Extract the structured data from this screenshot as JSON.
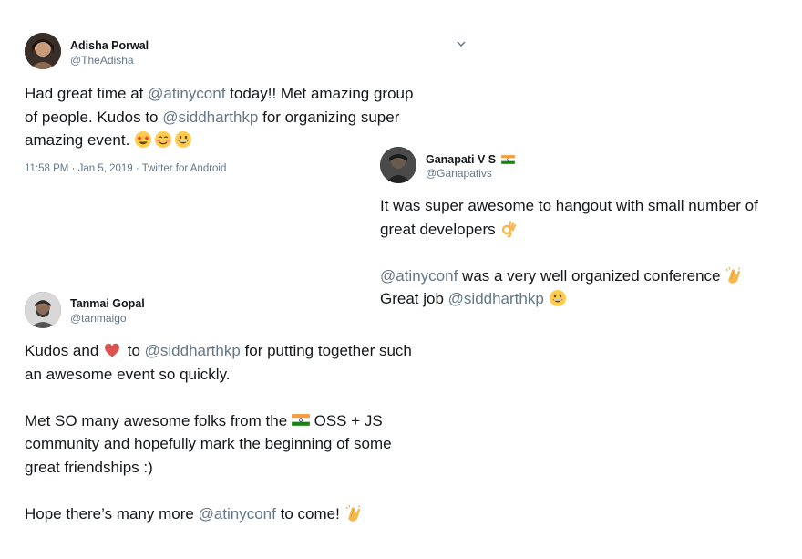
{
  "tweets": [
    {
      "name": "Adisha Porwal",
      "handle": "@TheAdisha",
      "paragraphs": [
        {
          "lines": [
            [
              {
                "t": "Had great time at "
              },
              {
                "m": "@atinyconf"
              },
              {
                "t": " today!! Met amazing group"
              }
            ],
            [
              {
                "t": "of people. Kudos to "
              },
              {
                "m": "@siddharthkp"
              },
              {
                "t": " for organizing super"
              }
            ],
            [
              {
                "t": "amazing event. "
              },
              {
                "e": "star-struck-emoji"
              },
              {
                "e": "smiling-eyes-emoji"
              },
              {
                "e": "grinning-emoji"
              }
            ]
          ]
        }
      ],
      "meta": "11:58 PM · Jan 5, 2019 · Twitter for Android",
      "menu_icon": "chevron-down-icon"
    },
    {
      "name": "Ganapati V S",
      "name_badge": "india-flag-icon",
      "handle": "@Ganapativs",
      "paragraphs": [
        {
          "lines": [
            [
              {
                "t": "It was super awesome to hangout with small number of"
              }
            ],
            [
              {
                "t": "great developers "
              },
              {
                "e": "ok-hand-emoji"
              }
            ]
          ]
        },
        {
          "lines": [
            [
              {
                "m": "@atinyconf"
              },
              {
                "t": " was a very well organized conference "
              },
              {
                "e": "clapping-hands-emoji"
              }
            ],
            [
              {
                "t": "Great job "
              },
              {
                "m": "@siddharthkp"
              },
              {
                "t": " "
              },
              {
                "e": "grinning-emoji"
              }
            ]
          ]
        }
      ]
    },
    {
      "name": "Tanmai Gopal",
      "handle": "@tanmaigo",
      "paragraphs": [
        {
          "lines": [
            [
              {
                "t": "Kudos and "
              },
              {
                "e": "red-heart-emoji"
              },
              {
                "t": " to "
              },
              {
                "m": "@siddharthkp"
              },
              {
                "t": " for putting together such"
              }
            ],
            [
              {
                "t": "an awesome event so quickly."
              }
            ]
          ]
        },
        {
          "lines": [
            [
              {
                "t": "Met SO many awesome folks from the "
              },
              {
                "e": "india-flag-icon"
              },
              {
                "t": " OSS + JS"
              }
            ],
            [
              {
                "t": "community and hopefully mark the beginning of some"
              }
            ],
            [
              {
                "t": "great friendships :)"
              }
            ]
          ]
        },
        {
          "lines": [
            [
              {
                "t": "Hope there’s many more "
              },
              {
                "m": "@atinyconf"
              },
              {
                "t": " to come! "
              },
              {
                "e": "clapping-hands-emoji"
              }
            ]
          ]
        }
      ]
    }
  ],
  "colors": {
    "text": "#14171a",
    "secondary": "#657786",
    "mention": "#657786"
  }
}
